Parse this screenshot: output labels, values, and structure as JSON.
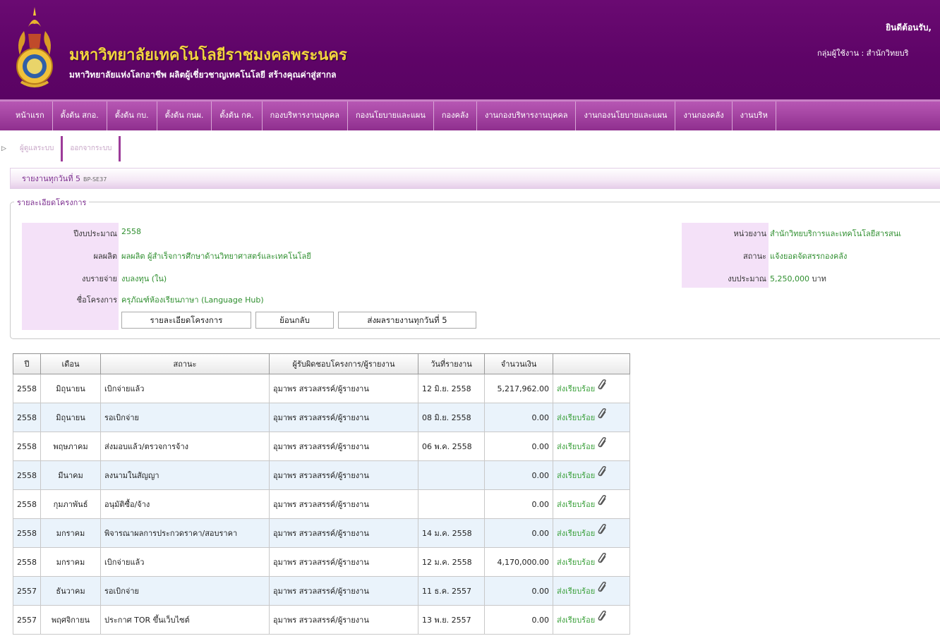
{
  "header": {
    "university_name": "มหาวิทยาลัยเทคโนโลยีราชมงคลพระนคร",
    "slogan": "มหาวิทยาลัยแห่งโลกอาชีพ ผลิตผู้เชี่ยวชาญเทคโนโลยี สร้างคุณค่าสู่สากล",
    "welcome": "ยินดีต้อนรับ,",
    "user_group": "กลุ่มผู้ใช้งาน : สำนักวิทยบริ",
    "colors": {
      "banner": "#5e0467",
      "title_gold": "#f3d43f",
      "nav": "#a448a2"
    }
  },
  "nav": {
    "items": [
      "หน้าแรก",
      "ตั้งต้น สกอ.",
      "ตั้งต้น กบ.",
      "ตั้งต้น กนผ.",
      "ตั้งต้น กค.",
      "กองบริหารงานบุคคล",
      "กองนโยบายและแผน",
      "กองคลัง",
      "งานกองบริหารงานบุคคล",
      "งานกองนโยบายและแผน",
      "งานกองคลัง",
      "งานบริห"
    ]
  },
  "subnav": {
    "items": [
      "ผู้ดูแลระบบ",
      "ออกจากระบบ"
    ]
  },
  "page": {
    "title": "รายงานทุกวันที่ 5",
    "code": "BP-SE37"
  },
  "project": {
    "legend": "รายละเอียดโครงการ",
    "left": [
      {
        "label": "ปีงบประมาณ",
        "value": "2558"
      },
      {
        "label": "ผลผลิต",
        "value": "ผลผลิต ผู้สำเร็จการศึกษาด้านวิทยาศาสตร์และเทคโนโลยี"
      },
      {
        "label": "งบรายจ่าย",
        "value": "งบลงทุน (ใน)"
      },
      {
        "label": "ชื่อโครงการ",
        "value": "ครุภัณฑ์ห้องเรียนภาษา (Language Hub)"
      }
    ],
    "right": [
      {
        "label": "หน่วยงาน",
        "value": "สำนักวิทยบริการและเทคโนโลยีสารสนเ"
      },
      {
        "label": "สถานะ",
        "value": "แจ้งยอดจัดสรรกองคลัง"
      },
      {
        "label": "งบประมาณ",
        "value": "5,250,000",
        "unit": "บาท"
      }
    ],
    "buttons": [
      "รายละเอียดโครงการ",
      "ย้อนกลับ",
      "ส่งผลรายงานทุกวันที่ 5"
    ]
  },
  "table": {
    "headers": [
      "ปี",
      "เดือน",
      "สถานะ",
      "ผู้รับผิดชอบโครงการ/ผู้รายงาน",
      "วันที่รายงาน",
      "จำนวนเงิน",
      ""
    ],
    "rows": [
      {
        "year": "2558",
        "month": "มิถุนายน",
        "status": "เบิกจ่ายแล้ว",
        "reporter": "อุมาพร สรวลสรรค์/ผู้รายงาน",
        "date": "12 มิ.ย. 2558",
        "amount": "5,217,962.00",
        "sent": "ส่งเรียบร้อย"
      },
      {
        "year": "2558",
        "month": "มิถุนายน",
        "status": "รอเบิกจ่าย",
        "reporter": "อุมาพร สรวลสรรค์/ผู้รายงาน",
        "date": "08 มิ.ย. 2558",
        "amount": "0.00",
        "sent": "ส่งเรียบร้อย"
      },
      {
        "year": "2558",
        "month": "พฤษภาคม",
        "status": "ส่งมอบแล้ว/ตรวจการจ้าง",
        "reporter": "อุมาพร สรวลสรรค์/ผู้รายงาน",
        "date": "06 พ.ค. 2558",
        "amount": "0.00",
        "sent": "ส่งเรียบร้อย"
      },
      {
        "year": "2558",
        "month": "มีนาคม",
        "status": "ลงนามในสัญญา",
        "reporter": "อุมาพร สรวลสรรค์/ผู้รายงาน",
        "date": "",
        "amount": "0.00",
        "sent": "ส่งเรียบร้อย"
      },
      {
        "year": "2558",
        "month": "กุมภาพันธ์",
        "status": "อนุมัติซื้อ/จ้าง",
        "reporter": "อุมาพร สรวลสรรค์/ผู้รายงาน",
        "date": "",
        "amount": "0.00",
        "sent": "ส่งเรียบร้อย"
      },
      {
        "year": "2558",
        "month": "มกราคม",
        "status": "พิจารณาผลการประกวดราคา/สอบราคา",
        "reporter": "อุมาพร สรวลสรรค์/ผู้รายงาน",
        "date": "14 ม.ค. 2558",
        "amount": "0.00",
        "sent": "ส่งเรียบร้อย"
      },
      {
        "year": "2558",
        "month": "มกราคม",
        "status": "เบิกจ่ายแล้ว",
        "reporter": "อุมาพร สรวลสรรค์/ผู้รายงาน",
        "date": "12 ม.ค. 2558",
        "amount": "4,170,000.00",
        "sent": "ส่งเรียบร้อย"
      },
      {
        "year": "2557",
        "month": "ธันวาคม",
        "status": "รอเบิกจ่าย",
        "reporter": "อุมาพร สรวลสรรค์/ผู้รายงาน",
        "date": "11 ธ.ค. 2557",
        "amount": "0.00",
        "sent": "ส่งเรียบร้อย"
      },
      {
        "year": "2557",
        "month": "พฤศจิกายน",
        "status": "ประกาศ TOR ขึ้นเว็บไซต์",
        "reporter": "อุมาพร สรวลสรรค์/ผู้รายงาน",
        "date": "13 พ.ย. 2557",
        "amount": "0.00",
        "sent": "ส่งเรียบร้อย"
      }
    ],
    "row_icon": "paperclip-icon"
  }
}
